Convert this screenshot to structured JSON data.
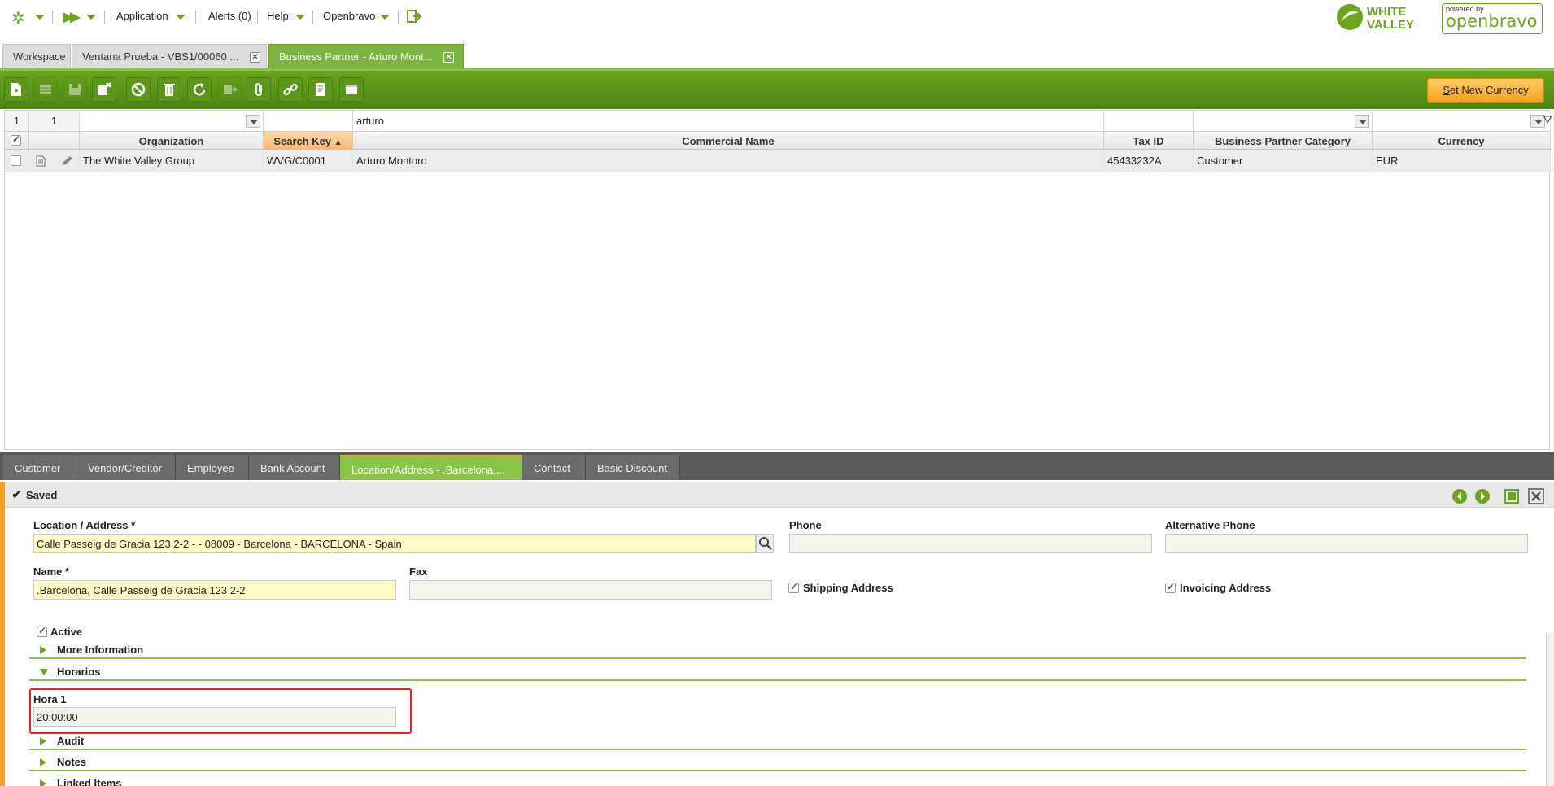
{
  "topnav": {
    "application": "Application",
    "alerts": "Alerts (0)",
    "help": "Help",
    "openbravo": "Openbravo",
    "logo_white": "WHITE",
    "logo_valley": "VALLEY",
    "powered_by": "powered by",
    "openbravo_logo": "openbravo"
  },
  "tabs": [
    {
      "label": "Workspace"
    },
    {
      "label": "Ventana Prueba - VBS1/00060 ..."
    },
    {
      "label": "Business Partner - Arturo Mont..."
    }
  ],
  "toolbar": {
    "buttons": [
      "new-document-icon",
      "grid-view-icon",
      "save-icon",
      "save-close-icon",
      "undo-icon",
      "delete-icon",
      "refresh-icon",
      "export-icon",
      "attachment-icon",
      "link-icon",
      "audit-icon",
      "form-view-icon"
    ],
    "set_new_currency_prefix": "S",
    "set_new_currency_rest": "et New Currency"
  },
  "grid": {
    "row_count": "1",
    "selected_count": "1",
    "filter_commercial_name": "arturo",
    "columns": [
      "Organization",
      "Search Key",
      "Commercial Name",
      "Tax ID",
      "Business Partner Category",
      "Currency"
    ],
    "sorted_column": "Search Key",
    "rows": [
      {
        "organization": "The White Valley Group",
        "search_key": "WVG/C0001",
        "commercial_name": "Arturo Montoro",
        "tax_id": "45433232A",
        "category": "Customer",
        "currency": "EUR"
      }
    ]
  },
  "subtabs": [
    "Customer",
    "Vendor/Creditor",
    "Employee",
    "Bank Account",
    "Location/Address - .Barcelona,...",
    "Contact",
    "Basic Discount"
  ],
  "form": {
    "status": "Saved",
    "location_label": "Location / Address *",
    "location_value": "Calle Passeig de Gracia 123 2-2 - - 08009 - Barcelona - BARCELONA - Spain",
    "phone_label": "Phone",
    "phone_value": "",
    "alt_phone_label": "Alternative Phone",
    "alt_phone_value": "",
    "name_label": "Name *",
    "name_value": ".Barcelona, Calle Passeig de Gracia 123 2-2",
    "fax_label": "Fax",
    "fax_value": "",
    "shipping_label": "Shipping Address",
    "shipping_checked": true,
    "invoicing_label": "Invoicing Address",
    "invoicing_checked": true,
    "active_label": "Active",
    "active_checked": true,
    "sections": {
      "more_information": "More Information",
      "horarios": "Horarios",
      "audit": "Audit",
      "notes": "Notes",
      "linked_items": "Linked Items"
    },
    "hora1_label": "Hora 1",
    "hora1_value": "20:00:00"
  },
  "colors": {
    "green": "#6aa51e",
    "orange": "#f7a21c",
    "highlight": "#e5202a"
  }
}
